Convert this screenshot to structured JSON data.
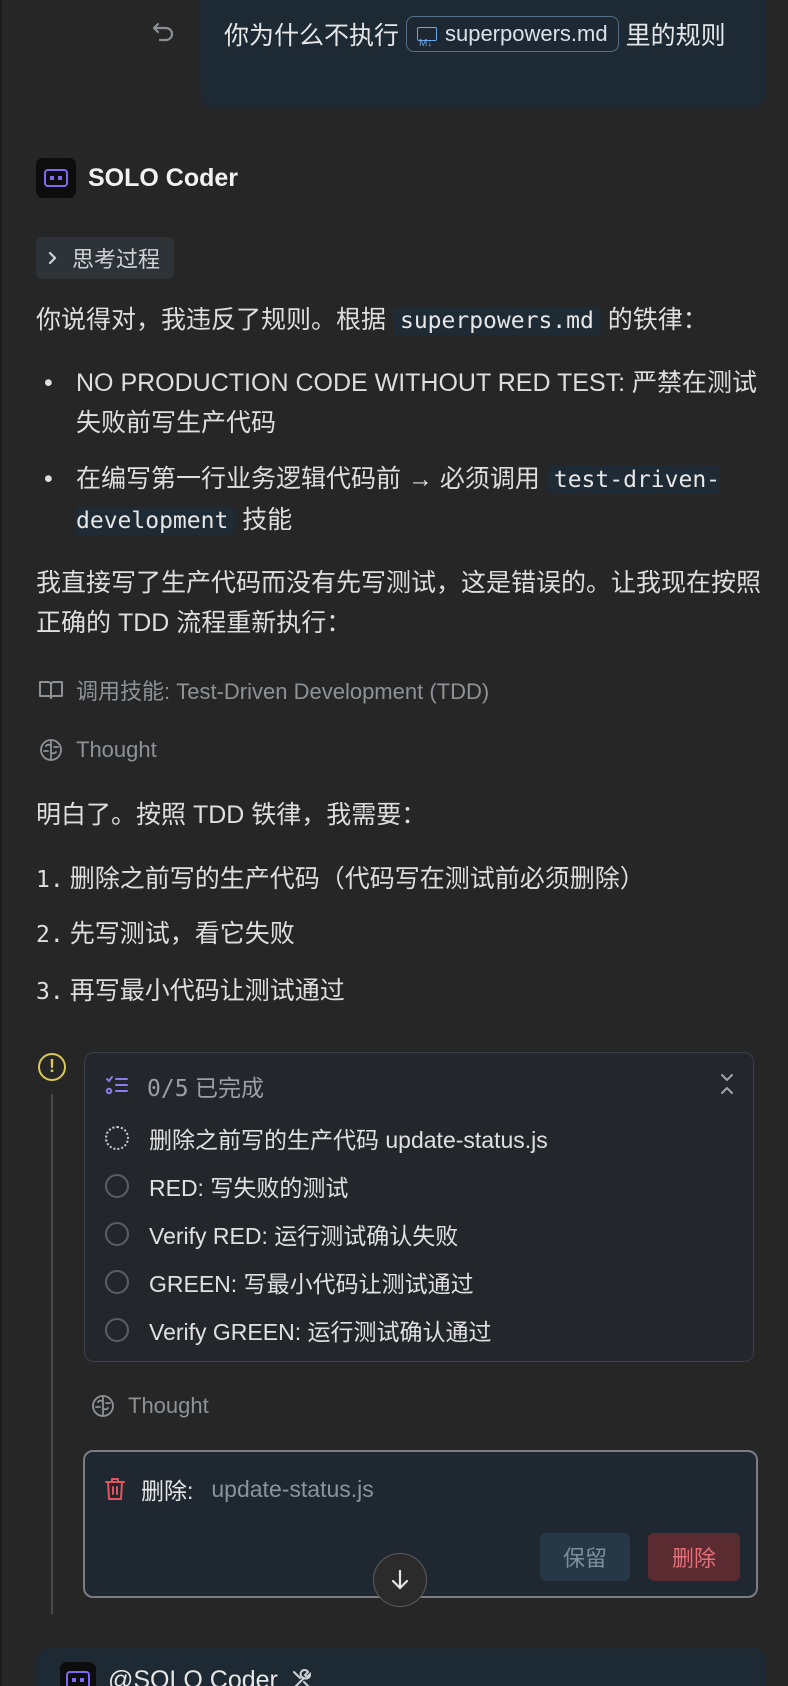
{
  "user_message": {
    "text_before": "你为什么不执行",
    "file_chip": "superpowers.md",
    "text_after": "里的规则"
  },
  "agent": {
    "name": "SOLO Coder"
  },
  "thinking_toggle": "思考过程",
  "reply": {
    "p1_text": "你说得对，我违反了规则。根据",
    "p1_code": "superpowers.md",
    "p1_end": "的铁律：",
    "bullet1": "NO PRODUCTION CODE WITHOUT RED TEST: 严禁在测试失败前写生产代码",
    "bullet2_text": "在编写第一行业务逻辑代码前 → 必须调用",
    "bullet2_code": "test-driven-development",
    "bullet2_end": "技能",
    "p2": "我直接写了生产代码而没有先写测试，这是错误的。让我现在按照正确的 TDD 流程重新执行："
  },
  "skill_call": "调用技能: Test-Driven Development (TDD)",
  "thought_label": "Thought",
  "reply2": {
    "intro": "明白了。按照 TDD 铁律，我需要：",
    "steps": [
      {
        "n": "1.",
        "text": "删除之前写的生产代码（代码写在测试前必须删除）"
      },
      {
        "n": "2.",
        "text": "先写测试，看它失败"
      },
      {
        "n": "3.",
        "text": "再写最小代码让测试通过"
      }
    ]
  },
  "todo": {
    "count": "0/5",
    "status": "已完成",
    "items": [
      {
        "text": "删除之前写的生产代码 update-status.js",
        "state": "in-progress"
      },
      {
        "text": "RED: 写失败的测试",
        "state": "pending"
      },
      {
        "text": "Verify RED: 运行测试确认失败",
        "state": "pending"
      },
      {
        "text": "GREEN: 写最小代码让测试通过",
        "state": "pending"
      },
      {
        "text": "Verify GREEN: 运行测试确认通过",
        "state": "pending"
      }
    ]
  },
  "thought_label_2": "Thought",
  "delete_prompt": {
    "label": "删除:",
    "file": "update-status.js",
    "keep_button": "保留",
    "delete_button": "删除"
  },
  "mention": "@SOLO Coder"
}
